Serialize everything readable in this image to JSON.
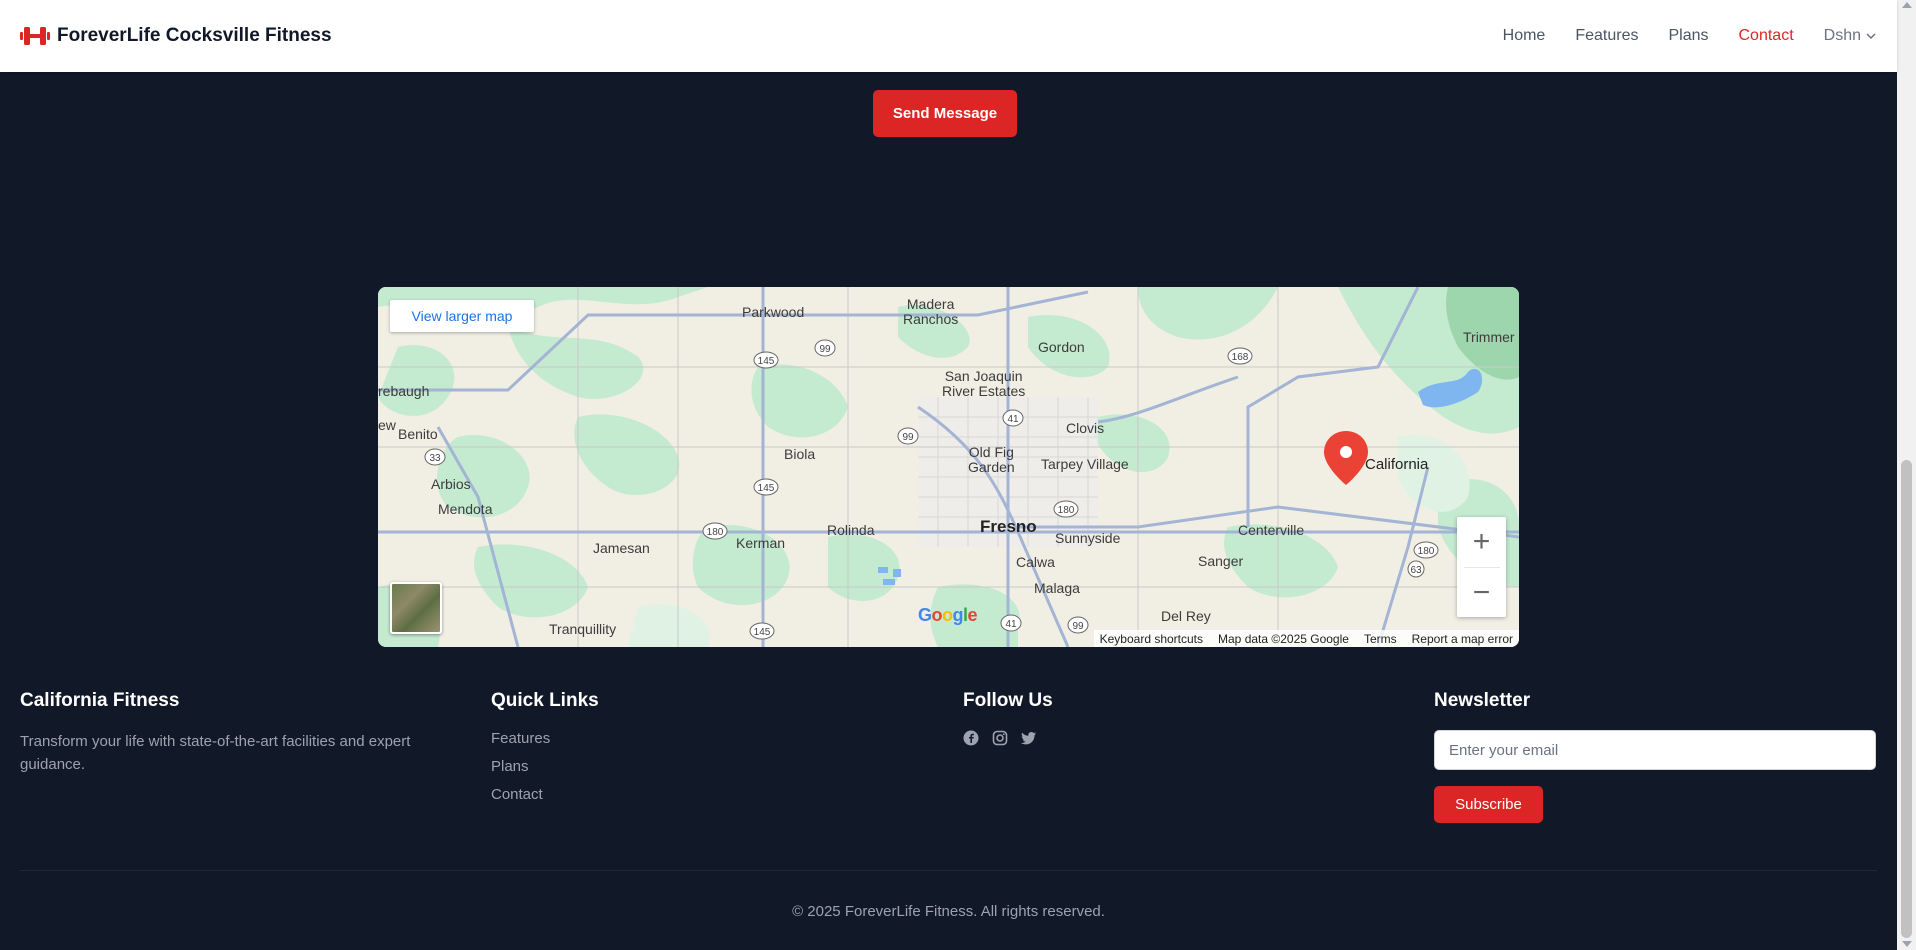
{
  "header": {
    "brand": "ForeverLife Cocksville Fitness",
    "nav": [
      "Home",
      "Features",
      "Plans",
      "Contact"
    ],
    "active_nav": "Contact",
    "user": "Dshn"
  },
  "contact": {
    "send_label": "Send Message"
  },
  "map": {
    "view_larger": "View larger map",
    "zoom_in": "+",
    "zoom_out": "−",
    "google": "Google",
    "attribution": [
      "Keyboard shortcuts",
      "Map data ©2025 Google",
      "Terms",
      "Report a map error"
    ],
    "marker_label": "California",
    "places": {
      "madera_ranchos": "Madera\nRanchos",
      "parkwood": "Parkwood",
      "gordon": "Gordon",
      "trimmer": "Trimmer",
      "san_joaquin": "San Joaquin\nRiver Estates",
      "raymond": "rebaugh",
      "benito": "Benito",
      "clovis": "Clovis",
      "biola": "Biola",
      "old_fig": "Old Fig\nGarden",
      "tarpey": "Tarpey Village",
      "arbios": "Arbios",
      "mendota": "Mendota",
      "fresno": "Fresno",
      "sunnyside": "Sunnyside",
      "centerville": "Centerville",
      "kerman": "Kerman",
      "rolinda": "Rolinda",
      "jamesan": "Jamesan",
      "calwa": "Calwa",
      "sanger": "Sanger",
      "malaga": "Malaga",
      "del_rey": "Del Rey",
      "tranquillity": "Tranquillity",
      "ew": "ew"
    },
    "shields": [
      "145",
      "99",
      "168",
      "41",
      "33",
      "99",
      "41",
      "145",
      "180",
      "180",
      "180",
      "63",
      "145",
      "41",
      "99"
    ]
  },
  "footer": {
    "about": {
      "title": "California Fitness",
      "text": "Transform your life with state-of-the-art facilities and expert guidance."
    },
    "quick_links": {
      "title": "Quick Links",
      "items": [
        "Features",
        "Plans",
        "Contact"
      ]
    },
    "follow": {
      "title": "Follow Us",
      "icons": [
        "facebook-icon",
        "instagram-icon",
        "twitter-icon"
      ]
    },
    "newsletter": {
      "title": "Newsletter",
      "placeholder": "Enter your email",
      "button": "Subscribe"
    },
    "copyright": "© 2025 ForeverLife Fitness. All rights reserved."
  },
  "colors": {
    "accent": "#dc2626",
    "background": "#111827",
    "map_green": "#bfe8cb",
    "map_land": "#f1eee4"
  }
}
